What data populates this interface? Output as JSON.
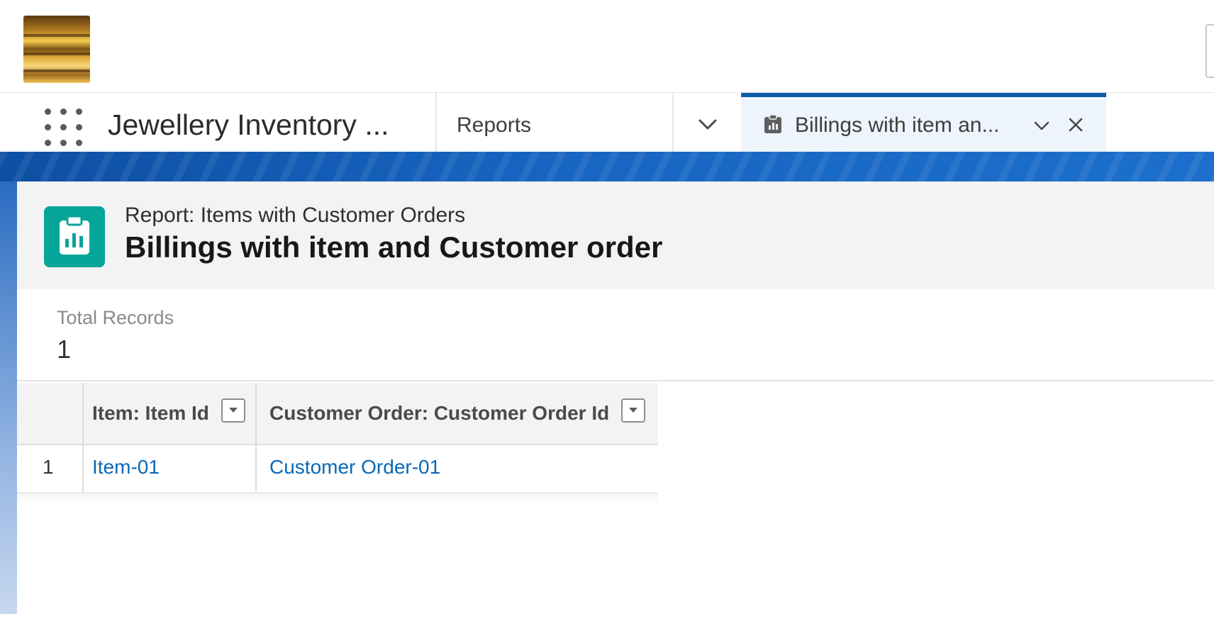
{
  "header": {
    "logo": "jewellery-shelves-logo"
  },
  "nav": {
    "app_name": "Jewellery Inventory ...",
    "reports_label": "Reports",
    "active_tab": {
      "label": "Billings with item an...",
      "icon": "report-icon"
    }
  },
  "page": {
    "subtitle": "Report: Items with Customer Orders",
    "title": "Billings with item and Customer order"
  },
  "summary": {
    "label": "Total Records",
    "value": "1"
  },
  "table": {
    "columns": [
      "Item: Item Id",
      "Customer Order: Customer Order Id"
    ],
    "rows": [
      {
        "num": "1",
        "cells": [
          "Item-01",
          "Customer Order-01"
        ]
      }
    ]
  },
  "colors": {
    "brand_blue": "#0b5cab",
    "report_icon_bg": "#06a59a",
    "link": "#0b67b8"
  }
}
